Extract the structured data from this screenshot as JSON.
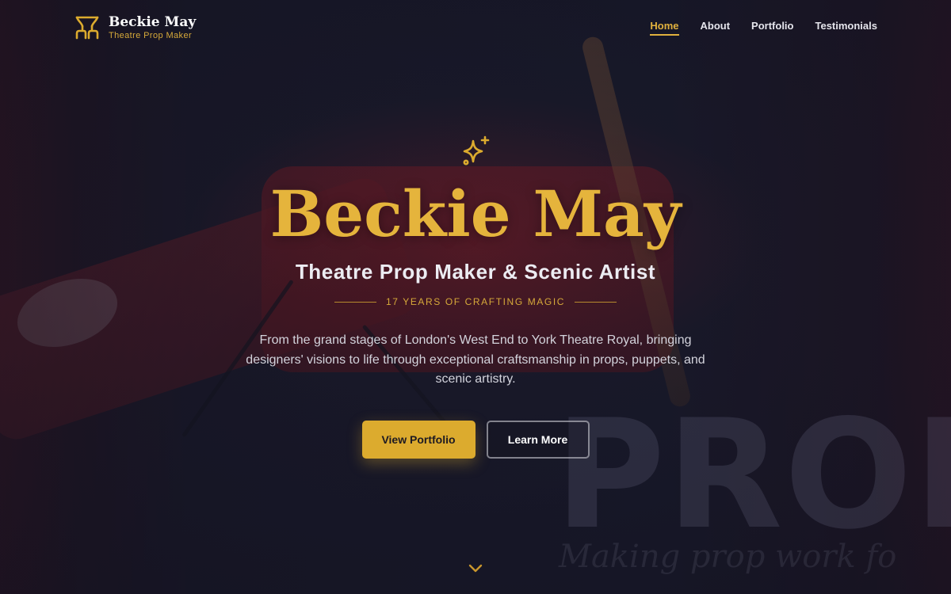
{
  "brand": {
    "name": "Beckie May",
    "tagline": "Theatre Prop Maker",
    "logo_icon": "theatre-curtain-icon"
  },
  "nav": {
    "items": [
      {
        "label": "Home",
        "active": true
      },
      {
        "label": "About",
        "active": false
      },
      {
        "label": "Portfolio",
        "active": false
      },
      {
        "label": "Testimonials",
        "active": false
      }
    ]
  },
  "hero": {
    "icon": "sparkle-icon",
    "title": "Beckie May",
    "subtitle": "Theatre Prop Maker & Scenic Artist",
    "tagline": "17 YEARS OF CRAFTING MAGIC",
    "description": "From the grand stages of London's West End to York Theatre Royal, bringing designers' visions to life through exceptional craftsmanship in props, puppets, and scenic artistry.",
    "primary_cta": "View Portfolio",
    "secondary_cta": "Learn More",
    "scroll_icon": "chevron-down-icon"
  },
  "background": {
    "sign_text": "PROP",
    "sign_script": "Making prop work fo"
  },
  "colors": {
    "accent": "#e0b13d",
    "button_primary": "#dcab2e",
    "background": "#1b1c2e"
  }
}
